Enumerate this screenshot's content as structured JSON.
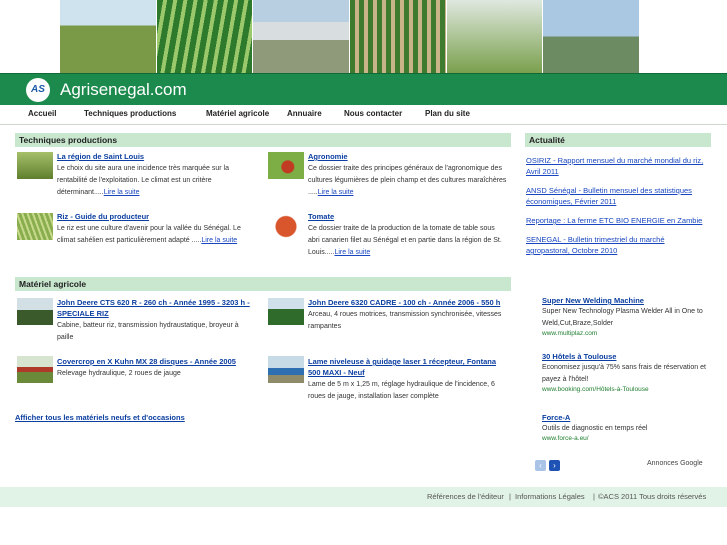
{
  "site": {
    "title": "Agrisenegal.com",
    "logo_text": "AS"
  },
  "nav": [
    "Accueil",
    "Techniques productions",
    "Matériel agricole",
    "Annuaire",
    "Nous contacter",
    "Plan du site"
  ],
  "techniques": {
    "heading": "Techniques productions",
    "items": [
      {
        "title": "La région de Saint Louis",
        "text": "Le choix du site aura une incidence très marquée sur la rentabilité de l'exploitation. Le climat est un critère déterminant.....",
        "more": "Lire la suite"
      },
      {
        "title": "Agronomie",
        "text": "Ce dossier traite des principes généraux de l'agronomique des cultures légumières de plein champ et des cultures maraîchères .....",
        "more": "Lire la suite"
      },
      {
        "title": "Riz - Guide du producteur",
        "text": "Le riz est une culture d'avenir pour la vallée du Sénégal. Le climat sahélien est particulièrement adapté .....",
        "more": "Lire la suite"
      },
      {
        "title": "Tomate",
        "text": "Ce dossier traite de la production de la tomate de table sous abri canarien filet au Sénégal et en partie dans la région de St. Louis.....",
        "more": "Lire la suite"
      }
    ]
  },
  "materiel": {
    "heading": "Matériel agricole",
    "items": [
      {
        "title": "John Deere CTS 620 R - 260 ch - Année 1995 - 3203 h - SPECIALE RIZ",
        "text": "Cabine, batteur riz, transmission hydraustatique, broyeur à paille"
      },
      {
        "title": "John Deere 6320 CADRE - 100 ch - Année 2006 - 550 h",
        "text": "Arceau, 4 roues motrices, transmission synchronisée, vitesses rampantes"
      },
      {
        "title": "Covercrop en X Kuhn MX 28 disques - Année 2005",
        "text": "Relevage hydraulique, 2 roues de jauge"
      },
      {
        "title": "Lame niveleuse à guidage laser 1 récepteur, Fontana 500 MAXI - Neuf",
        "text": "Lame de 5 m x 1,25 m, réglage hydraulique de l'incidence, 6 roues de jauge, installation laser complète"
      }
    ],
    "all_link": "Afficher tous les matériels neufs et d'occasions"
  },
  "news": {
    "heading": "Actualité",
    "items": [
      "OSIRIZ - Rapport mensuel du marché mondial du riz, Avril 2011",
      "ANSD Sénégal - Bulletin mensuel des statistiques économiques, Février 2011",
      "Reportage : La ferme ETC BIO ENERGIE en Zambie",
      "SENEGAL - Bulletin trimestriel du marché agropastoral, Octobre 2010"
    ]
  },
  "ads": {
    "items": [
      {
        "title": "Super New Welding Machine",
        "text": "Super New Technology Plasma Welder All in One to Weld,Cut,Braze,Solder",
        "url": "www.multiplaz.com"
      },
      {
        "title": "30 Hôtels à Toulouse",
        "text": "Economisez jusqu'à 75% sans frais de réservation et payez à l'hôtel!",
        "url": "www.booking.com/Hôtels-à-Toulouse"
      },
      {
        "title": "Force-A",
        "text": "Outils de diagnostic en temps réel",
        "url": "www.force-a.eu/"
      }
    ],
    "label": "Annonces Google",
    "prev_icon": "chevron-left-icon",
    "next_icon": "chevron-right-icon"
  },
  "footer": {
    "links": [
      "Références de l'éditeur",
      "Informations Légales"
    ],
    "copyright": "©ACS 2011 Tous droits réservés"
  },
  "colors": {
    "header": "#1c8a4c",
    "section": "#c9e7cf",
    "link": "#1846c0",
    "footer": "#e1f2e6"
  }
}
